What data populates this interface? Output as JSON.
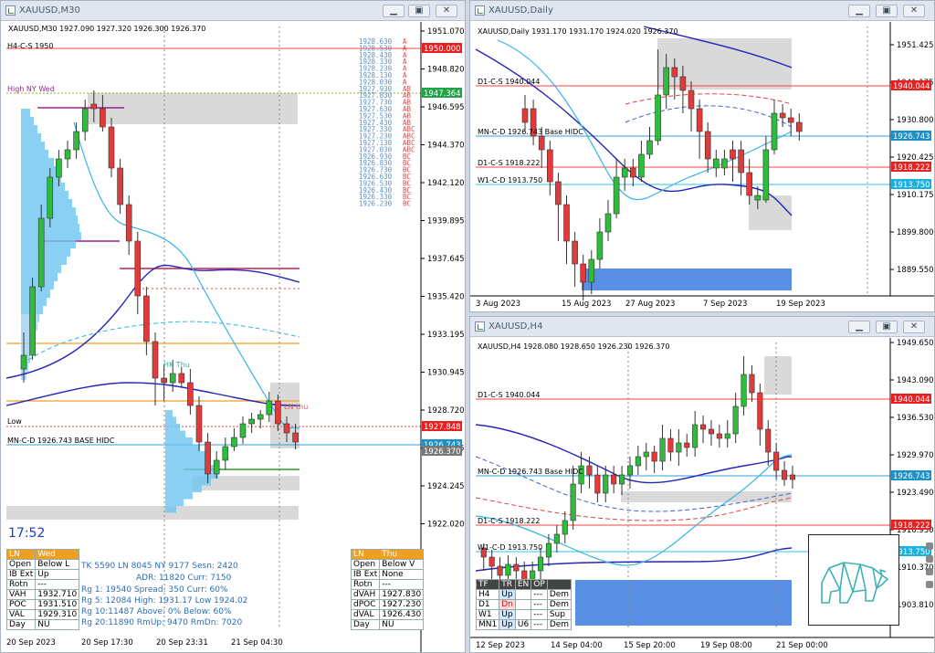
{
  "colors": {
    "bull": "#2dbd3a",
    "bear": "#e03a3a",
    "gray": "#d6d6d6",
    "blue": "#2525b8",
    "cyan": "#34b4e6",
    "gridDash": "#888888",
    "red": "#ff3030",
    "orange": "#f0a020"
  },
  "m30": {
    "title": "XAUUSD,M30",
    "ohlc": "XAUUSD,M30  1927.090 1927.320 1926.300 1926.370",
    "h4label": "H4-C-S 1950",
    "high_nywed": "High NY Wed",
    "hk_thu": "HK Thu",
    "ln_thu": "LN thu",
    "low_label": "Low",
    "base_label": "MN-C-D 1926.743 BASE HIDC",
    "clock": "17:52",
    "prices": [
      "1951.070",
      "1948.820",
      "1946.595",
      "1944.370",
      "1942.120",
      "1939.895",
      "1937.645",
      "1935.420",
      "1933.195",
      "1930.945",
      "1928.720",
      "1926.495",
      "1924.245",
      "1922.020"
    ],
    "price_flags": [
      {
        "text": "1950.000",
        "color": "#e82020"
      },
      {
        "text": "1947.364",
        "color": "#21a34a"
      },
      {
        "text": "1927.848",
        "color": "#e82020"
      },
      {
        "text": "1926.743",
        "color": "#1e90c8"
      },
      {
        "text": "1926.370",
        "color": "#777777"
      }
    ],
    "ladder": [
      {
        "p": "1928.630",
        "c": "A"
      },
      {
        "p": "1928.530",
        "c": "A"
      },
      {
        "p": "1928.430",
        "c": "A"
      },
      {
        "p": "1928.330",
        "c": "A"
      },
      {
        "p": "1928.230",
        "c": "A"
      },
      {
        "p": "1928.130",
        "c": "A"
      },
      {
        "p": "1928.030",
        "c": "A"
      },
      {
        "p": "1927.930",
        "c": "AB"
      },
      {
        "p": "1927.830",
        "c": "AB"
      },
      {
        "p": "1927.730",
        "c": "AB"
      },
      {
        "p": "1927.630",
        "c": "AB"
      },
      {
        "p": "1927.530",
        "c": "AB"
      },
      {
        "p": "1927.430",
        "c": "AB"
      },
      {
        "p": "1927.330",
        "c": "ABC"
      },
      {
        "p": "1927.230",
        "c": "ABC"
      },
      {
        "p": "1927.130",
        "c": "ABC"
      },
      {
        "p": "1927.030",
        "c": "ABC"
      },
      {
        "p": "1926.930",
        "c": "BC"
      },
      {
        "p": "1926.830",
        "c": "BC"
      },
      {
        "p": "1926.730",
        "c": "BC"
      },
      {
        "p": "1926.630",
        "c": "BC"
      },
      {
        "p": "1926.530",
        "c": "BC"
      },
      {
        "p": "1926.430",
        "c": "BC"
      },
      {
        "p": "1926.330",
        "c": "BC"
      },
      {
        "p": "1926.230",
        "c": "BC"
      }
    ],
    "dates": [
      "20 Sep 2023",
      "20 Sep 17:30",
      "20 Sep 23:31",
      "21 Sep 04:30"
    ],
    "panel_left": {
      "header_l": "LN",
      "header_r": "Wed",
      "rows": [
        [
          "Open",
          "Below L"
        ],
        [
          "IB Ext",
          "Up"
        ],
        [
          "Rotn",
          "---"
        ],
        [
          "VAH",
          "1932.710"
        ],
        [
          "POC",
          "1931.510"
        ],
        [
          "VAL",
          "1929.310"
        ],
        [
          "Day",
          "NU"
        ]
      ]
    },
    "panel_right": {
      "header_l": "LN",
      "header_r": "Thu",
      "rows": [
        [
          "Open",
          "Below V"
        ],
        [
          "IB Ext",
          "None"
        ],
        [
          "Rotn",
          "---"
        ],
        [
          "dVAH",
          "1927.830"
        ],
        [
          "dPOC",
          "1927.230"
        ],
        [
          "dVAL",
          "1926.430"
        ],
        [
          "Day",
          "NU"
        ]
      ]
    },
    "stats": [
      "TK 5590  LN 8045  NY 9177   Sesn: 2420",
      "ADR:   11820   Curr:   7150",
      "Rg 1: 19540 Spread: 350   Curr:   60%",
      "Rg 5: 12084 High:  1931.17  Low   1924.02",
      "Rg 10:11487 Above:   0%     Below:  60%",
      "Rg 20:11890 RmUp: 9470    RmDn: 7020"
    ]
  },
  "daily": {
    "title": "XAUUSD,Daily",
    "ohlc": "XAUUSD,Daily  1931.170 1931.170 1924.020 1926.370",
    "prices": [
      "1951.425",
      "1941.175",
      "1930.800",
      "1920.425",
      "1910.175",
      "1899.800",
      "1889.550"
    ],
    "flags": [
      {
        "text": "1940.044",
        "color": "#e82020"
      },
      {
        "text": "1926.743",
        "color": "#1e90c8"
      },
      {
        "text": "1918.222",
        "color": "#e82020"
      },
      {
        "text": "1913.750",
        "color": "#1ab0e0"
      }
    ],
    "labels": [
      "D1-C-S 1940.044",
      "MN-C-D 1926.743 Base HIDC",
      "D1-C-S 1918.222",
      "W1-C-D 1913.750"
    ],
    "dates": [
      "3 Aug 2023",
      "15 Aug 2023",
      "27 Aug 2023",
      "7 Sep 2023",
      "19 Sep 2023"
    ]
  },
  "h4": {
    "title": "XAUUSD,H4",
    "ohlc": "XAUUSD,H4  1928.080 1928.650 1926.230 1926.370",
    "prices": [
      "1949.650",
      "1943.090",
      "1936.530",
      "1929.970",
      "1923.490",
      "1916.930",
      "1910.370",
      "1903.810"
    ],
    "flags": [
      {
        "text": "1940.044",
        "color": "#e82020"
      },
      {
        "text": "1926.743",
        "color": "#1e90c8"
      },
      {
        "text": "1918.222",
        "color": "#e82020"
      },
      {
        "text": "1913.750",
        "color": "#1ab0e0"
      }
    ],
    "labels": [
      "D1-C-S 1940.044",
      "MN-C-D 1926.743 Base HIDC",
      "D1-C-S 1918.222",
      "W1-C-D 1913.750"
    ],
    "dates": [
      "12 Sep 2023",
      "14 Sep 04:00",
      "15 Sep 20:00",
      "19 Sep 08:00",
      "21 Sep 00:00"
    ],
    "tf_table": {
      "headers": [
        "TF",
        "TR",
        "EN",
        "OP",
        ""
      ],
      "rows": [
        [
          "H4",
          "Up",
          "",
          "---",
          "Dem"
        ],
        [
          "D1",
          "Dn",
          "",
          "---",
          "Dem"
        ],
        [
          "W1",
          "Up",
          "",
          "---",
          "Sup"
        ],
        [
          "MN1",
          "Up",
          "U6",
          "---",
          "Dem"
        ]
      ]
    }
  }
}
